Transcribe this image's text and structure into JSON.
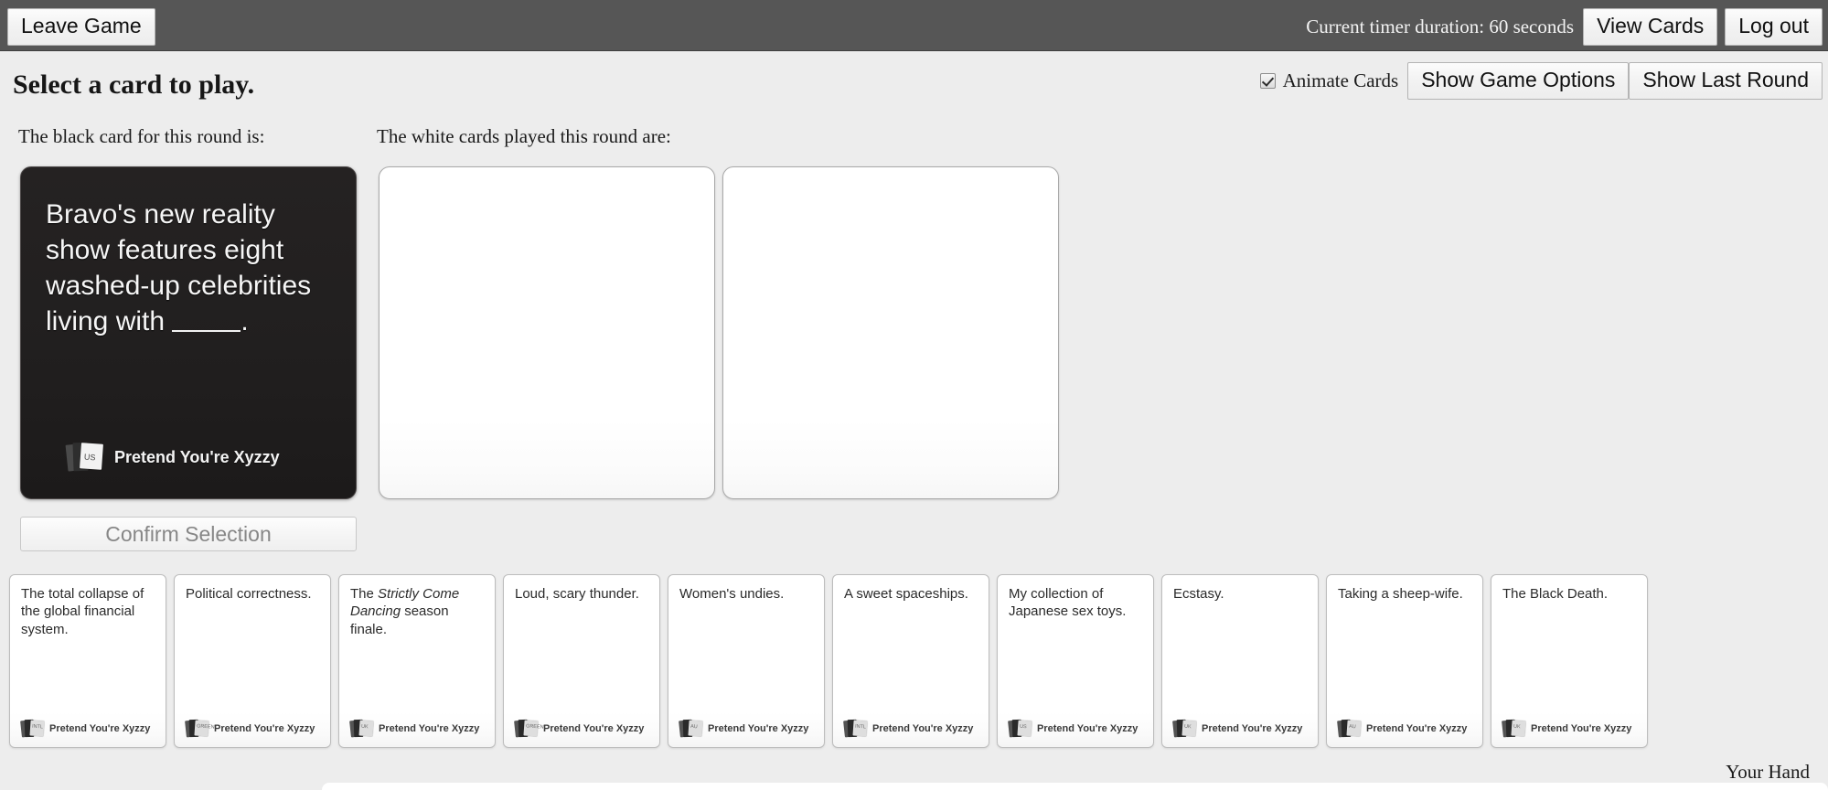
{
  "topbar": {
    "leave_game_label": "Leave Game",
    "timer_text": "Current timer duration: 60 seconds",
    "view_cards_label": "View Cards",
    "log_out_label": "Log out"
  },
  "header": {
    "page_title": "Select a card to play.",
    "animate_cards_label": "Animate Cards",
    "animate_cards_checked": true,
    "show_game_options_label": "Show Game Options",
    "show_last_round_label": "Show Last Round"
  },
  "labels": {
    "black_card": "The black card for this round is:",
    "white_cards": "The white cards played this round are:"
  },
  "black_card": {
    "text_before_blank": "Bravo's new reality show features eight washed-up celebrities living with ",
    "text_after_blank": ".",
    "deck": "US",
    "brand": "Pretend You're Xyzzy"
  },
  "played_cards": [
    {
      "id": "played-card-1",
      "text": ""
    },
    {
      "id": "played-card-2",
      "text": ""
    }
  ],
  "confirm_button": {
    "label": "Confirm Selection",
    "disabled": true
  },
  "hand": {
    "footer_label": "Your Hand",
    "brand": "Pretend You're Xyzzy",
    "cards": [
      {
        "text": "The total collapse of the global financial system.",
        "deck": "INTL"
      },
      {
        "text": "Political correctness.",
        "deck": "GREEN"
      },
      {
        "text_html": "The <i>Strictly Come Dancing</i> season finale.",
        "text": "The Strictly Come Dancing season finale.",
        "deck": "UK"
      },
      {
        "text": "Loud, scary thunder.",
        "deck": "GREEN"
      },
      {
        "text": "Women's undies.",
        "deck": "AU"
      },
      {
        "text": "A sweet spaceships.",
        "deck": "INTL"
      },
      {
        "text": "My collection of Japanese sex toys.",
        "deck": "US"
      },
      {
        "text": "Ecstasy.",
        "deck": "UK"
      },
      {
        "text": "Taking a sheep-wife.",
        "deck": "AU"
      },
      {
        "text": "The Black Death.",
        "deck": "UK"
      }
    ]
  },
  "colors": {
    "topbar_bg": "#565656",
    "page_bg": "#ededed",
    "black_card_bg": "#211f1f",
    "white_card_bg": "#ffffff",
    "text_dark": "#1a1a1a"
  }
}
